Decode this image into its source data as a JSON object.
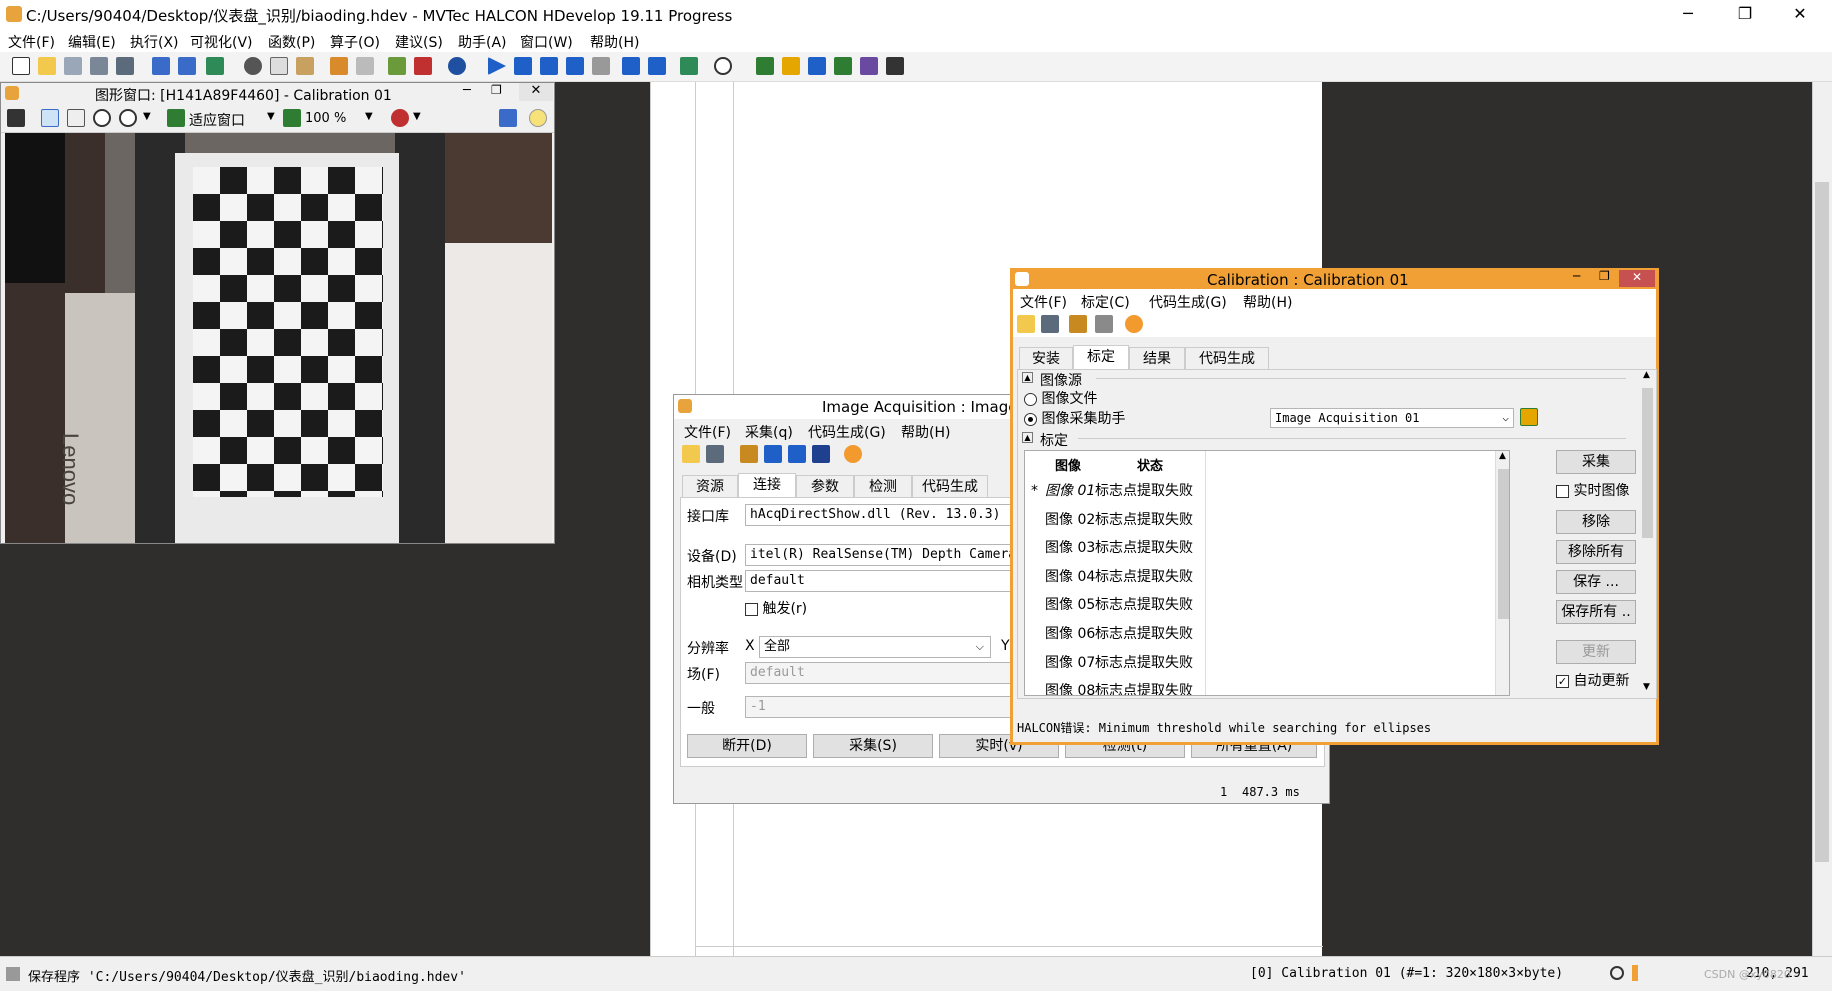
{
  "app": {
    "title": "C:/Users/90404/Desktop/仪表盘_识别/biaoding.hdev - MVTec HALCON HDevelop 19.11 Progress",
    "min": "─",
    "max": "❐",
    "close": "✕"
  },
  "menu": [
    "文件(F)",
    "编辑(E)",
    "执行(X)",
    "可视化(V)",
    "函数(P)",
    "算子(O)",
    "建议(S)",
    "助手(A)",
    "窗口(W)",
    "帮助(H)"
  ],
  "graphics_window": {
    "title": "图形窗口: [H141A89F4460] - Calibration 01",
    "fit_label": "适应窗口",
    "zoom_label": "100 %",
    "brand_text": "Lenovo"
  },
  "acq": {
    "title": "Image Acquisition : Image A",
    "menu": [
      "文件(F)",
      "采集(q)",
      "代码生成(G)",
      "帮助(H)"
    ],
    "tabs": [
      "资源",
      "连接",
      "参数",
      "检测",
      "代码生成"
    ],
    "interface_label": "接口库",
    "interface_value": "hAcqDirectShow.dll (Rev. 13.0.3)",
    "device_label": "设备(D)",
    "device_value": "itel(R) RealSense(TM) Depth Camera",
    "camtype_label": "相机类型",
    "camtype_value": "default",
    "trigger_label": "触发(r)",
    "resolution_label": "分辨率",
    "res_x": "X",
    "res_value": "全部",
    "res_y": "Y",
    "field_label": "场(F)",
    "field_value": "default",
    "general_label": "一般",
    "general_value": "-1",
    "buttons": [
      "断开(D)",
      "采集(S)",
      "实时(v)",
      "检测(t)",
      "所有重置(A)"
    ],
    "status_count": "1",
    "status_time": "487.3 ms"
  },
  "calib": {
    "title": "Calibration : Calibration 01",
    "menu": [
      "文件(F)",
      "标定(C)",
      "代码生成(G)",
      "帮助(H)"
    ],
    "tabs": [
      "安装",
      "标定",
      "结果",
      "代码生成"
    ],
    "section_source": "图像源",
    "radio_file": "图像文件",
    "radio_assistant": "图像采集助手",
    "assistant_value": "Image Acquisition 01",
    "section_calib": "标定",
    "col_image": "图像",
    "col_status": "状态",
    "rows": [
      {
        "mark": "*",
        "image": "图像 01",
        "status": "标志点提取失败"
      },
      {
        "mark": "",
        "image": "图像 02",
        "status": "标志点提取失败"
      },
      {
        "mark": "",
        "image": "图像 03",
        "status": "标志点提取失败"
      },
      {
        "mark": "",
        "image": "图像 04",
        "status": "标志点提取失败"
      },
      {
        "mark": "",
        "image": "图像 05",
        "status": "标志点提取失败"
      },
      {
        "mark": "",
        "image": "图像 06",
        "status": "标志点提取失败"
      },
      {
        "mark": "",
        "image": "图像 07",
        "status": "标志点提取失败"
      },
      {
        "mark": "",
        "image": "图像 08",
        "status": "标志点提取失败"
      }
    ],
    "btn_capture": "采集",
    "chk_live": "实时图像",
    "btn_remove": "移除",
    "btn_remove_all": "移除所有",
    "btn_save": "保存 ...",
    "btn_save_all": "保存所有 ..",
    "btn_update": "更新",
    "chk_auto": "自动更新",
    "error": "HALCON错误: Minimum threshold while searching for ellipses"
  },
  "status": {
    "left": "保存程序 'C:/Users/90404/Desktop/仪表盘_识别/biaoding.hdev'",
    "right": "[0] Calibration 01 (#=1: 320×180×3×byte)",
    "coords": "210, 291",
    "watermark": "CSDN @xy0820"
  }
}
